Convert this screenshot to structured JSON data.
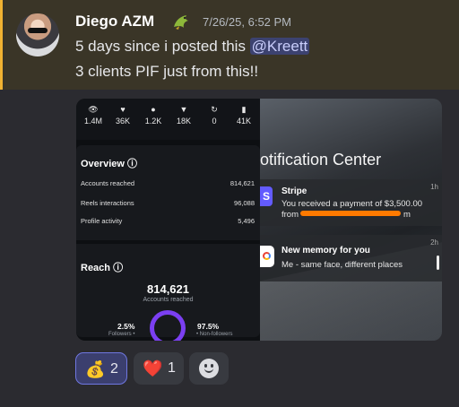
{
  "message": {
    "username": "Diego AZM",
    "badge_icon": "dragon-icon",
    "timestamp": "7/26/25, 6:52 PM",
    "line1_prefix": "5 days since i posted this ",
    "mention": "@Kreett",
    "line2": "3 clients PIF just from this!!",
    "accent_color": "#f0b232"
  },
  "left_image": {
    "stats": [
      {
        "icon": "eye-icon",
        "glyph": "👁",
        "value": "1.4M"
      },
      {
        "icon": "heart-icon",
        "glyph": "♥",
        "value": "36K"
      },
      {
        "icon": "comment-icon",
        "glyph": "●",
        "value": "1.2K"
      },
      {
        "icon": "send-icon",
        "glyph": "▼",
        "value": "18K"
      },
      {
        "icon": "repost-icon",
        "glyph": "↻",
        "value": "0"
      },
      {
        "icon": "bookmark-icon",
        "glyph": "▮",
        "value": "41K"
      }
    ],
    "overview": {
      "title": "Overview ⓘ",
      "rows": [
        {
          "label": "Accounts reached",
          "value": "814,621"
        },
        {
          "label": "Reels interactions",
          "value": "96,088"
        },
        {
          "label": "Profile activity",
          "value": "5,496"
        }
      ]
    },
    "reach": {
      "title": "Reach ⓘ",
      "number": "814,621",
      "subtitle": "Accounts reached",
      "followers_pct": "2.5%",
      "followers_label": "Followers •",
      "non_followers_pct": "97.5%",
      "non_followers_label": "• Non-followers"
    }
  },
  "right_image": {
    "title": "otification Center",
    "notifications": [
      {
        "app": "Stripe",
        "body1": "You received a payment of $3,500.00",
        "body2_start": "from",
        "body2_end": "m",
        "time": "1h"
      },
      {
        "app": "New memory for you",
        "body1": "Me - same face, different places",
        "time": "2h"
      }
    ]
  },
  "reactions": [
    {
      "emoji": "💰",
      "icon": "money-bag-icon",
      "count": "2",
      "active": true
    },
    {
      "emoji": "❤️",
      "icon": "heart-icon",
      "count": "1",
      "active": false
    }
  ],
  "add_reaction_icon": "smiley-icon"
}
